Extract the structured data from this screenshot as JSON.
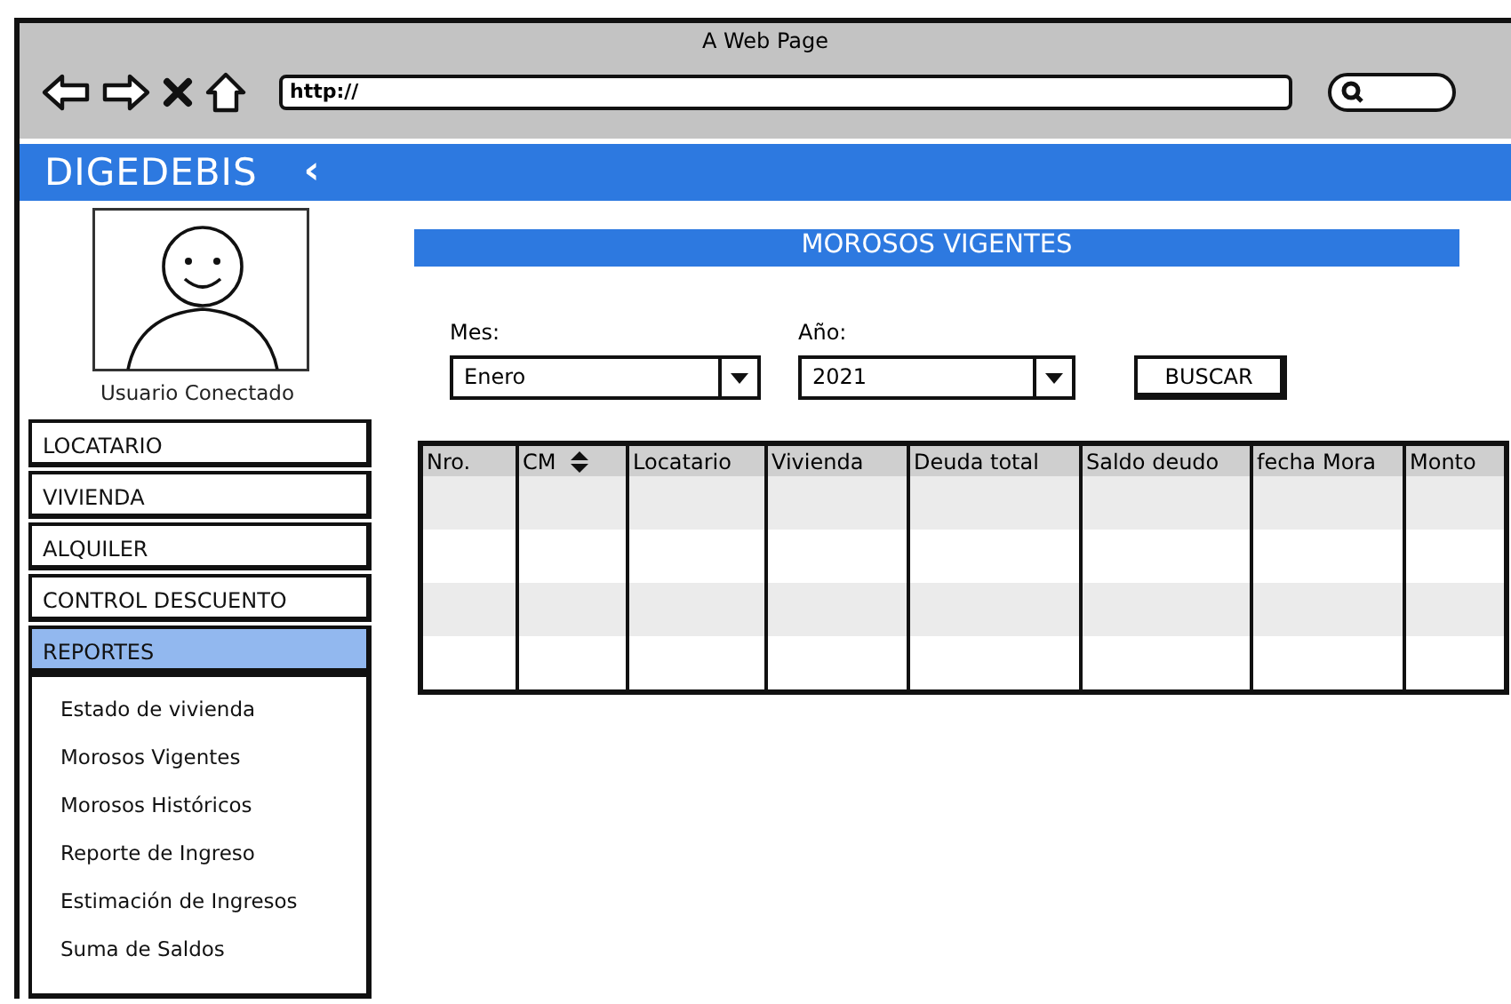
{
  "window": {
    "title": "A Web Page",
    "address": "http://"
  },
  "app": {
    "brand": "DIGEDEBIS",
    "collapse_icon": "‹"
  },
  "user": {
    "caption": "Usuario Conectado"
  },
  "menu": [
    {
      "label": "LOCATARIO",
      "selected": false
    },
    {
      "label": "VIVIENDA",
      "selected": false
    },
    {
      "label": "ALQUILER",
      "selected": false
    },
    {
      "label": "CONTROL DESCUENTO",
      "selected": false
    },
    {
      "label": "REPORTES",
      "selected": true,
      "children": [
        {
          "label": "Estado de vivienda",
          "selected": false
        },
        {
          "label": "Morosos Vigentes",
          "selected": false
        },
        {
          "label": "Morosos Históricos",
          "selected": false
        },
        {
          "label": "Reporte de Ingreso",
          "selected": false
        },
        {
          "label": "Estimación de Ingresos",
          "selected": false
        },
        {
          "label": "Suma de Saldos",
          "selected": false
        }
      ]
    }
  ],
  "page": {
    "title": "MOROSOS VIGENTES"
  },
  "filters": [
    {
      "label": "Mes:",
      "value": "Enero"
    },
    {
      "label": "Año:",
      "value": "2021"
    }
  ],
  "search_button": "BUSCAR",
  "table": {
    "columns": [
      {
        "label": "Nro.",
        "sortable": false
      },
      {
        "label": "CM",
        "sortable": true
      },
      {
        "label": "Locatario",
        "sortable": false
      },
      {
        "label": "Vivienda",
        "sortable": false
      },
      {
        "label": "Deuda total",
        "sortable": false
      },
      {
        "label": "Saldo deudo",
        "sortable": false
      },
      {
        "label": "fecha Mora",
        "sortable": false
      },
      {
        "label": "Monto",
        "sortable": false
      }
    ]
  }
}
